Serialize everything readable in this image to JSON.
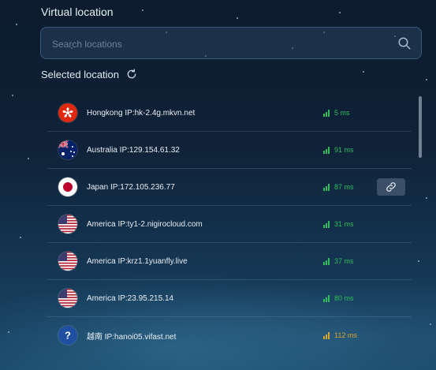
{
  "header": {
    "title": "Virtual location"
  },
  "search": {
    "placeholder": "Search locations",
    "value": ""
  },
  "selected": {
    "label": "Selected location"
  },
  "locations": [
    {
      "flag": "hongkong",
      "name": "Hongkong IP:hk-2.4g.mkvn.net",
      "ping": "5 ms",
      "status": "good"
    },
    {
      "flag": "australia",
      "name": "Australia IP:129.154.61.32",
      "ping": "91 ms",
      "status": "good"
    },
    {
      "flag": "japan",
      "name": "Japan IP:172.105.236.77",
      "ping": "87 ms",
      "status": "good",
      "has_link_button": true
    },
    {
      "flag": "usa",
      "name": "America IP:ty1-2.nigirocloud.com",
      "ping": "31 ms",
      "status": "good"
    },
    {
      "flag": "usa",
      "name": "America IP:krz1.1yuanfly.live",
      "ping": "37 ms",
      "status": "good"
    },
    {
      "flag": "usa",
      "name": "America IP:23.95.215.14",
      "ping": "80 ms",
      "status": "good"
    },
    {
      "flag": "unknown",
      "name": "越南 IP:hanoi05.vifast.net",
      "ping": "112 ms",
      "status": "warn"
    }
  ],
  "colors": {
    "good": "#2ebd5a",
    "warn": "#d7a52a",
    "accent": "#3b5068"
  },
  "icons": {
    "search": "search-icon",
    "refresh": "refresh-icon",
    "link": "link-icon"
  }
}
